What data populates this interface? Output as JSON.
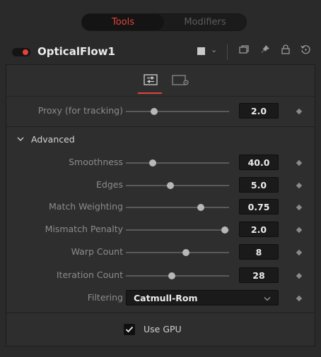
{
  "tabs": [
    {
      "label": "Tools",
      "active": true
    },
    {
      "label": "Modifiers",
      "active": false
    }
  ],
  "header": {
    "node_name": "OpticalFlow1",
    "enabled": true,
    "icons": [
      "color-swatch-icon",
      "chevron-down-icon",
      "version-icon",
      "pin-icon",
      "lock-icon",
      "reset-icon"
    ]
  },
  "inspector_tabs": [
    {
      "icon": "sliders-icon",
      "active": true
    },
    {
      "icon": "settings-icon",
      "active": false
    }
  ],
  "params": {
    "proxy": {
      "label": "Proxy (for tracking)",
      "value": "2.0",
      "slider": 0.25
    },
    "advanced_label": "Advanced",
    "smoothness": {
      "label": "Smoothness",
      "value": "40.0",
      "slider": 0.27
    },
    "edges": {
      "label": "Edges",
      "value": "5.0",
      "slider": 0.43
    },
    "match_weighting": {
      "label": "Match Weighting",
      "value": "0.75",
      "slider": 0.75
    },
    "mismatch_penalty": {
      "label": "Mismatch Penalty",
      "value": "2.0",
      "slider": 1.0
    },
    "warp_count": {
      "label": "Warp Count",
      "value": "8",
      "slider": 0.6
    },
    "iteration_count": {
      "label": "Iteration Count",
      "value": "28",
      "slider": 0.44
    },
    "filtering": {
      "label": "Filtering",
      "value": "Catmull-Rom"
    }
  },
  "use_gpu": {
    "label": "Use GPU",
    "checked": true
  },
  "colors": {
    "accent": "#e7413a",
    "background": "#2a2a2b",
    "field": "#1a1a1a"
  }
}
